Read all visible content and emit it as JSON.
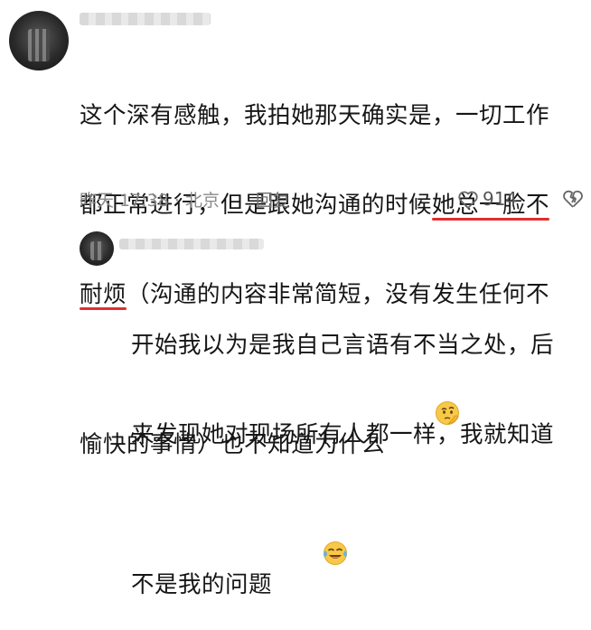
{
  "comment": {
    "username": "",
    "lines": [
      "这个深有感触，我拍她那天确实是，一切工作",
      "都正常进行，但是跟她沟通的时候",
      "耐烦（沟通的内容非常简短，没有发生任何不",
      "愉快的事情）也不知道为什么"
    ],
    "highlight_a": "她总一脸不",
    "highlight_b": "耐烦",
    "rest_line3": "（沟通的内容非常简短，没有发生任何不",
    "emoji": "thinking-face",
    "timestamp": "昨天 17:38 · 北京",
    "reply_label": "回复",
    "like_count": "914"
  },
  "reply": {
    "username": "",
    "lines": [
      "开始我以为是我自己言语有不当之处，后",
      "来发现她对现场所有人都一样，我就知道",
      "不是我的问题"
    ],
    "emoji": "laughing-crying-face"
  },
  "colors": {
    "underline": "#e02f2f",
    "meta_text": "#8a8a8a",
    "emoji_yellow": "#f8c948"
  }
}
